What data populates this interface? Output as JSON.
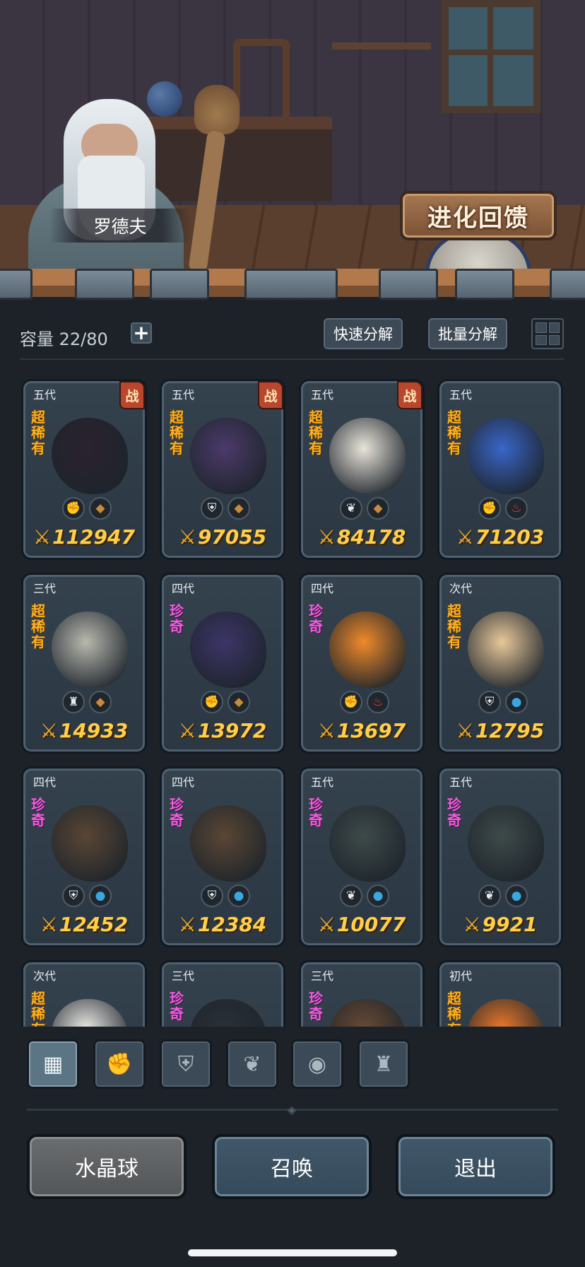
{
  "scene": {
    "npc_name": "罗德夫",
    "evolution_button": "进化回馈"
  },
  "toolbar": {
    "capacity_label": "容量 22/80",
    "quick_decompose": "快速分解",
    "batch_decompose": "批量分解"
  },
  "cards": [
    {
      "gen": "五代",
      "rarity": "超稀有",
      "tier": "sr",
      "battle": "战",
      "power": "112947",
      "class_icon": "fist",
      "element": "earth",
      "color": "#2b2230"
    },
    {
      "gen": "五代",
      "rarity": "超稀有",
      "tier": "sr",
      "battle": "战",
      "power": "97055",
      "class_icon": "shield",
      "element": "earth",
      "color": "#4b3a6a"
    },
    {
      "gen": "五代",
      "rarity": "超稀有",
      "tier": "sr",
      "battle": "战",
      "power": "84178",
      "class_icon": "sprout",
      "element": "earth",
      "color": "#e8e4da"
    },
    {
      "gen": "五代",
      "rarity": "超稀有",
      "tier": "sr",
      "battle": "",
      "power": "71203",
      "class_icon": "fist",
      "element": "fire",
      "color": "#3a66c8"
    },
    {
      "gen": "三代",
      "rarity": "超稀有",
      "tier": "sr",
      "battle": "",
      "power": "14933",
      "class_icon": "tower",
      "element": "earth",
      "color": "#b8b8ae"
    },
    {
      "gen": "四代",
      "rarity": "珍奇",
      "tier": "rare",
      "battle": "",
      "power": "13972",
      "class_icon": "fist",
      "element": "earth",
      "color": "#3c3568"
    },
    {
      "gen": "四代",
      "rarity": "珍奇",
      "tier": "rare",
      "battle": "",
      "power": "13697",
      "class_icon": "fist",
      "element": "fire",
      "color": "#f08a2a"
    },
    {
      "gen": "次代",
      "rarity": "超稀有",
      "tier": "sr",
      "battle": "",
      "power": "12795",
      "class_icon": "shield",
      "element": "water",
      "color": "#e8c89a"
    },
    {
      "gen": "四代",
      "rarity": "珍奇",
      "tier": "rare",
      "battle": "",
      "power": "12452",
      "class_icon": "shield",
      "element": "water",
      "color": "#5a4634"
    },
    {
      "gen": "四代",
      "rarity": "珍奇",
      "tier": "rare",
      "battle": "",
      "power": "12384",
      "class_icon": "shield",
      "element": "water",
      "color": "#5a4634"
    },
    {
      "gen": "五代",
      "rarity": "珍奇",
      "tier": "rare",
      "battle": "",
      "power": "10077",
      "class_icon": "sprout",
      "element": "water",
      "color": "#3e4a4a"
    },
    {
      "gen": "五代",
      "rarity": "珍奇",
      "tier": "rare",
      "battle": "",
      "power": "9921",
      "class_icon": "sprout",
      "element": "water",
      "color": "#3e4a4a"
    },
    {
      "gen": "次代",
      "rarity": "超稀有",
      "tier": "sr",
      "battle": "",
      "power": "",
      "class_icon": "",
      "element": "",
      "color": "#ecebe6"
    },
    {
      "gen": "三代",
      "rarity": "珍奇",
      "tier": "rare",
      "battle": "",
      "power": "",
      "class_icon": "",
      "element": "",
      "color": "#2a3038"
    },
    {
      "gen": "三代",
      "rarity": "珍奇",
      "tier": "rare",
      "battle": "",
      "power": "",
      "class_icon": "",
      "element": "",
      "color": "#6a4a34"
    },
    {
      "gen": "初代",
      "rarity": "超稀有",
      "tier": "sr",
      "battle": "",
      "power": "",
      "class_icon": "",
      "element": "",
      "color": "#f07a2a"
    }
  ],
  "icons": {
    "fist": "✊",
    "shield": "⛨",
    "sprout": "❦",
    "tower": "♜",
    "earth": "◆",
    "fire": "♨",
    "water": "●"
  },
  "element_colors": {
    "earth": "#c98a3a",
    "fire": "#e0443a",
    "water": "#3aa8e0"
  },
  "filters": [
    {
      "name": "all",
      "icon": "▦",
      "active": true
    },
    {
      "name": "fist",
      "icon": "✊",
      "active": false
    },
    {
      "name": "shield",
      "icon": "⛨",
      "active": false
    },
    {
      "name": "sprout",
      "icon": "❦",
      "active": false
    },
    {
      "name": "spirit",
      "icon": "◉",
      "active": false
    },
    {
      "name": "tower",
      "icon": "♜",
      "active": false
    }
  ],
  "bottom": {
    "crystal_ball": "水晶球",
    "summon": "召唤",
    "exit": "退出"
  }
}
